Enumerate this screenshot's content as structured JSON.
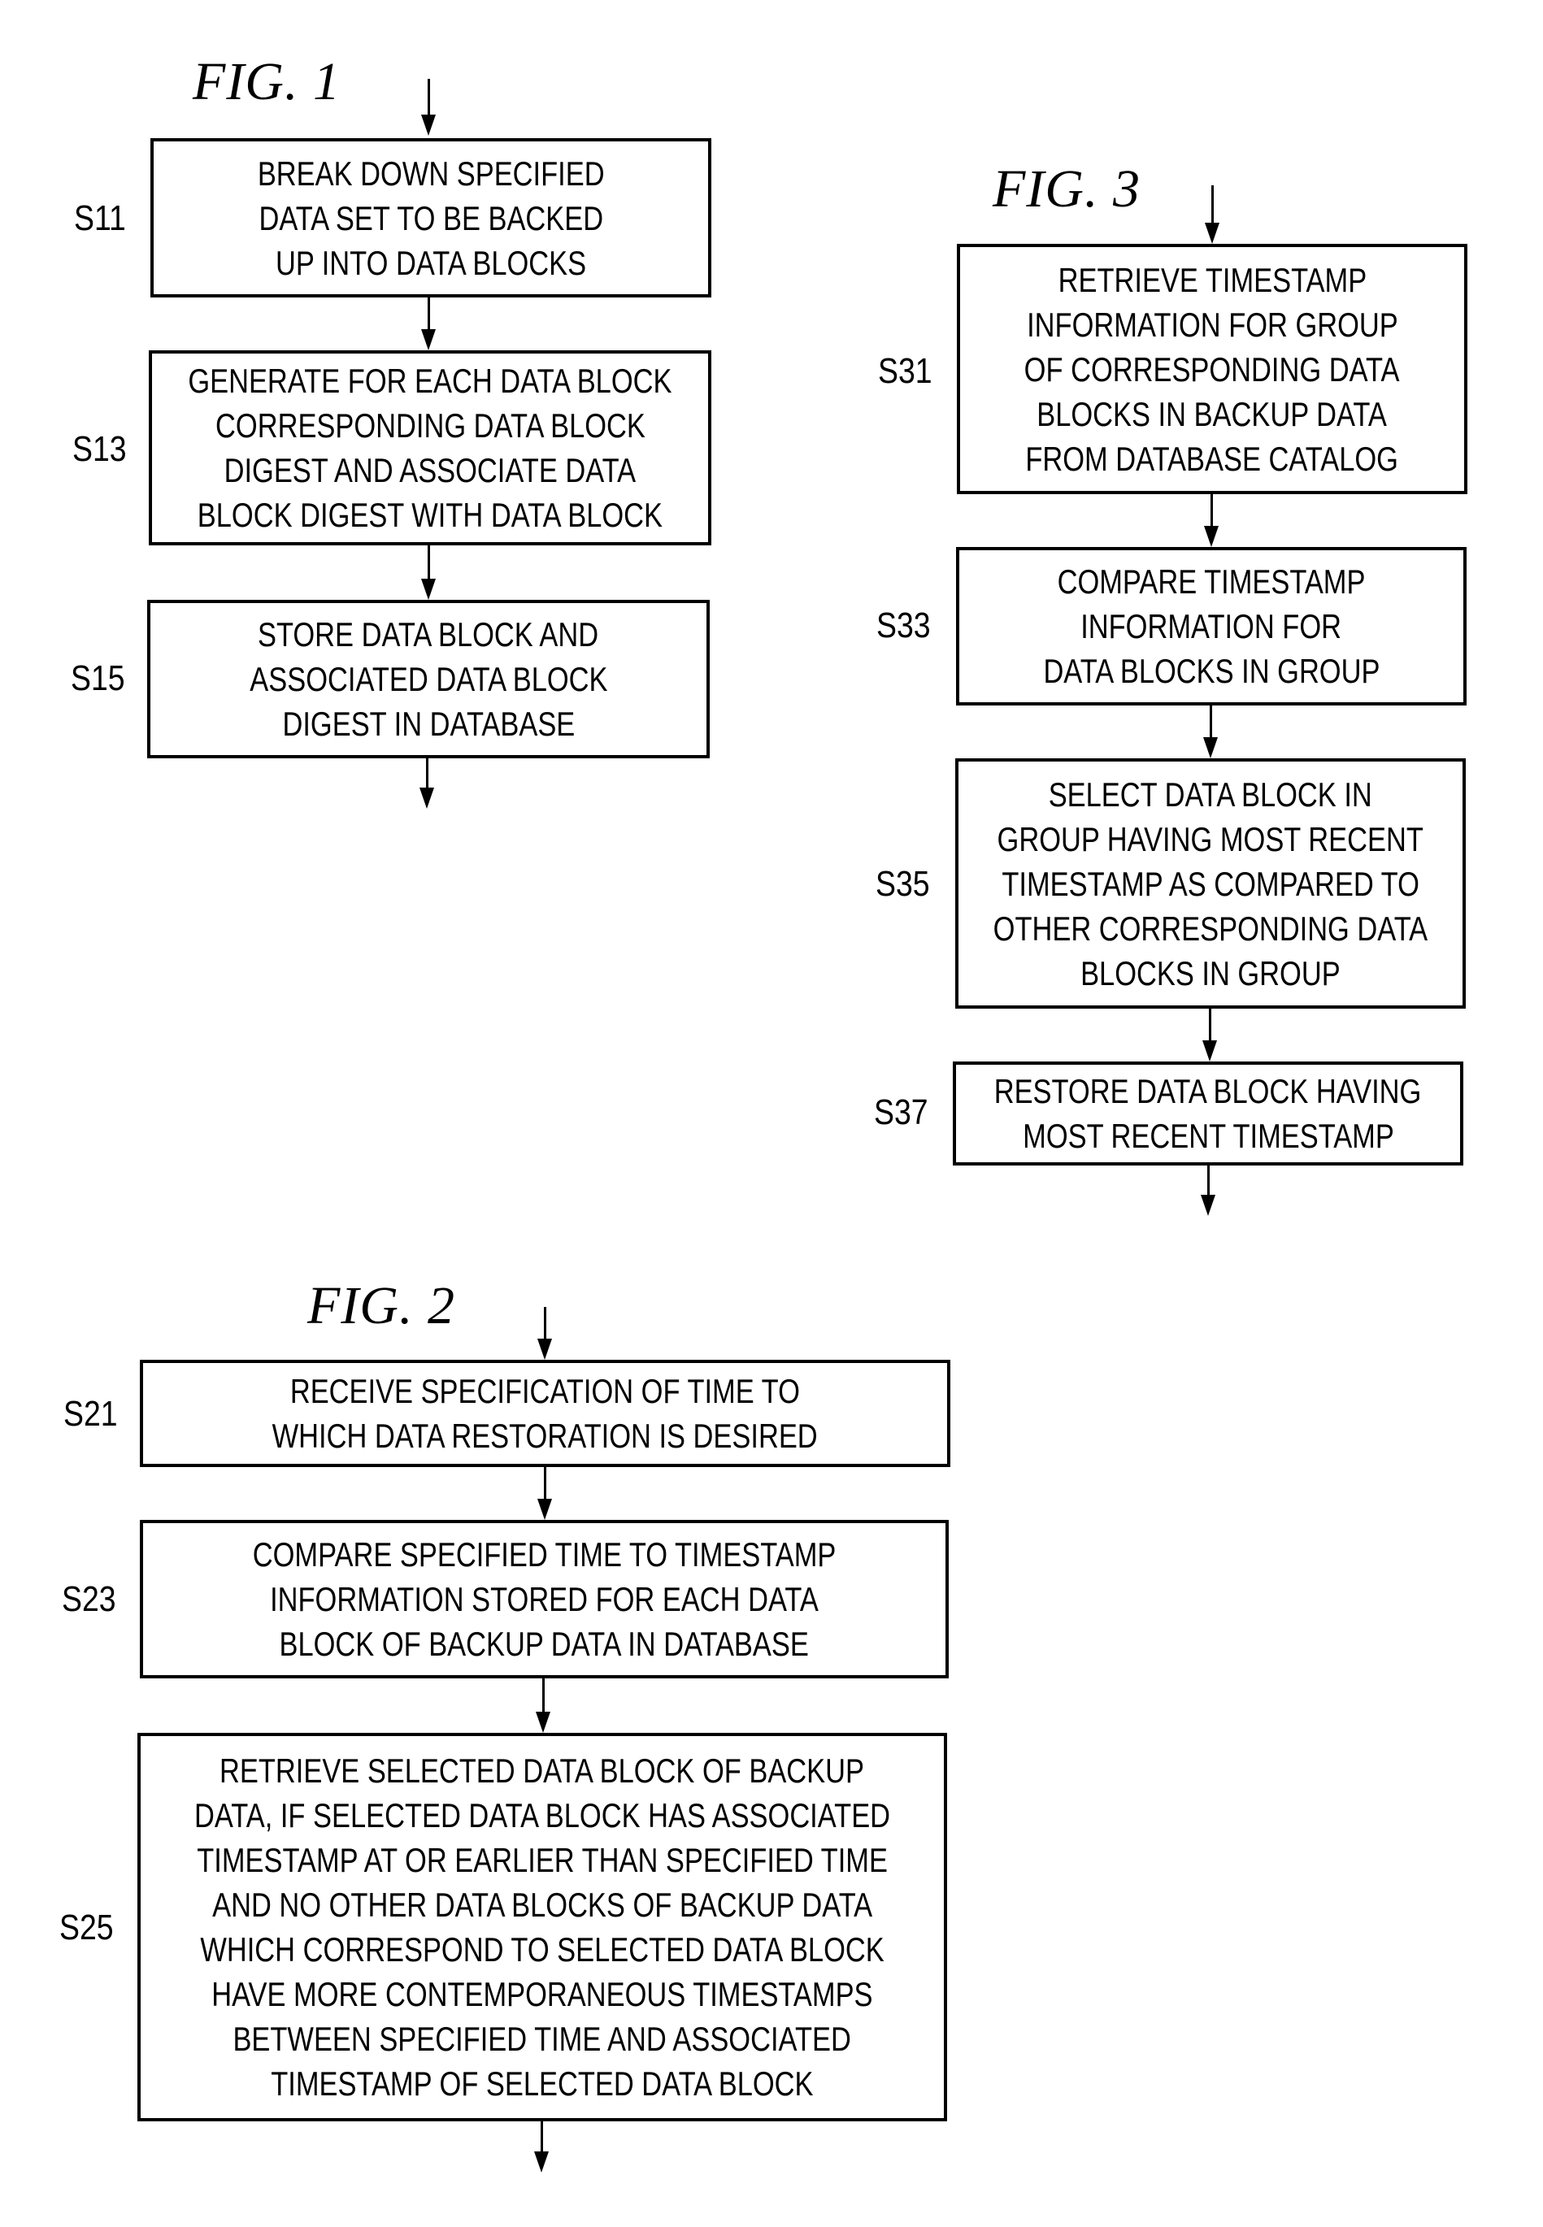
{
  "figures": [
    {
      "id": "fig1",
      "title": "FIG. 1",
      "steps": [
        {
          "label": "S11",
          "lines": [
            "BREAK DOWN SPECIFIED",
            "DATA SET TO BE BACKED",
            "UP INTO DATA BLOCKS"
          ]
        },
        {
          "label": "S13",
          "lines": [
            "GENERATE FOR EACH DATA BLOCK",
            "CORRESPONDING DATA BLOCK",
            "DIGEST AND ASSOCIATE DATA",
            "BLOCK DIGEST WITH DATA BLOCK"
          ]
        },
        {
          "label": "S15",
          "lines": [
            "STORE DATA BLOCK AND",
            "ASSOCIATED DATA BLOCK",
            "DIGEST IN DATABASE"
          ]
        }
      ]
    },
    {
      "id": "fig3",
      "title": "FIG. 3",
      "steps": [
        {
          "label": "S31",
          "lines": [
            "RETRIEVE TIMESTAMP",
            "INFORMATION FOR GROUP",
            "OF CORRESPONDING DATA",
            "BLOCKS IN BACKUP DATA",
            "FROM DATABASE CATALOG"
          ]
        },
        {
          "label": "S33",
          "lines": [
            "COMPARE TIMESTAMP",
            "INFORMATION FOR",
            "DATA BLOCKS IN GROUP"
          ]
        },
        {
          "label": "S35",
          "lines": [
            "SELECT DATA BLOCK IN",
            "GROUP HAVING MOST RECENT",
            "TIMESTAMP AS COMPARED TO",
            "OTHER CORRESPONDING DATA",
            "BLOCKS IN GROUP"
          ]
        },
        {
          "label": "S37",
          "lines": [
            "RESTORE DATA BLOCK HAVING",
            "MOST RECENT TIMESTAMP"
          ]
        }
      ]
    },
    {
      "id": "fig2",
      "title": "FIG. 2",
      "steps": [
        {
          "label": "S21",
          "lines": [
            "RECEIVE SPECIFICATION OF TIME TO",
            "WHICH DATA RESTORATION IS DESIRED"
          ]
        },
        {
          "label": "S23",
          "lines": [
            "COMPARE SPECIFIED TIME TO TIMESTAMP",
            "INFORMATION STORED FOR EACH DATA",
            "BLOCK OF BACKUP DATA IN DATABASE"
          ]
        },
        {
          "label": "S25",
          "lines": [
            "RETRIEVE SELECTED DATA BLOCK OF BACKUP",
            "DATA, IF SELECTED DATA BLOCK HAS ASSOCIATED",
            "TIMESTAMP AT OR EARLIER THAN SPECIFIED TIME",
            "AND NO OTHER DATA BLOCKS OF BACKUP DATA",
            "WHICH CORRESPOND TO SELECTED DATA BLOCK",
            "HAVE MORE CONTEMPORANEOUS TIMESTAMPS",
            "BETWEEN SPECIFIED TIME AND ASSOCIATED",
            "TIMESTAMP OF SELECTED DATA BLOCK"
          ]
        }
      ]
    }
  ]
}
